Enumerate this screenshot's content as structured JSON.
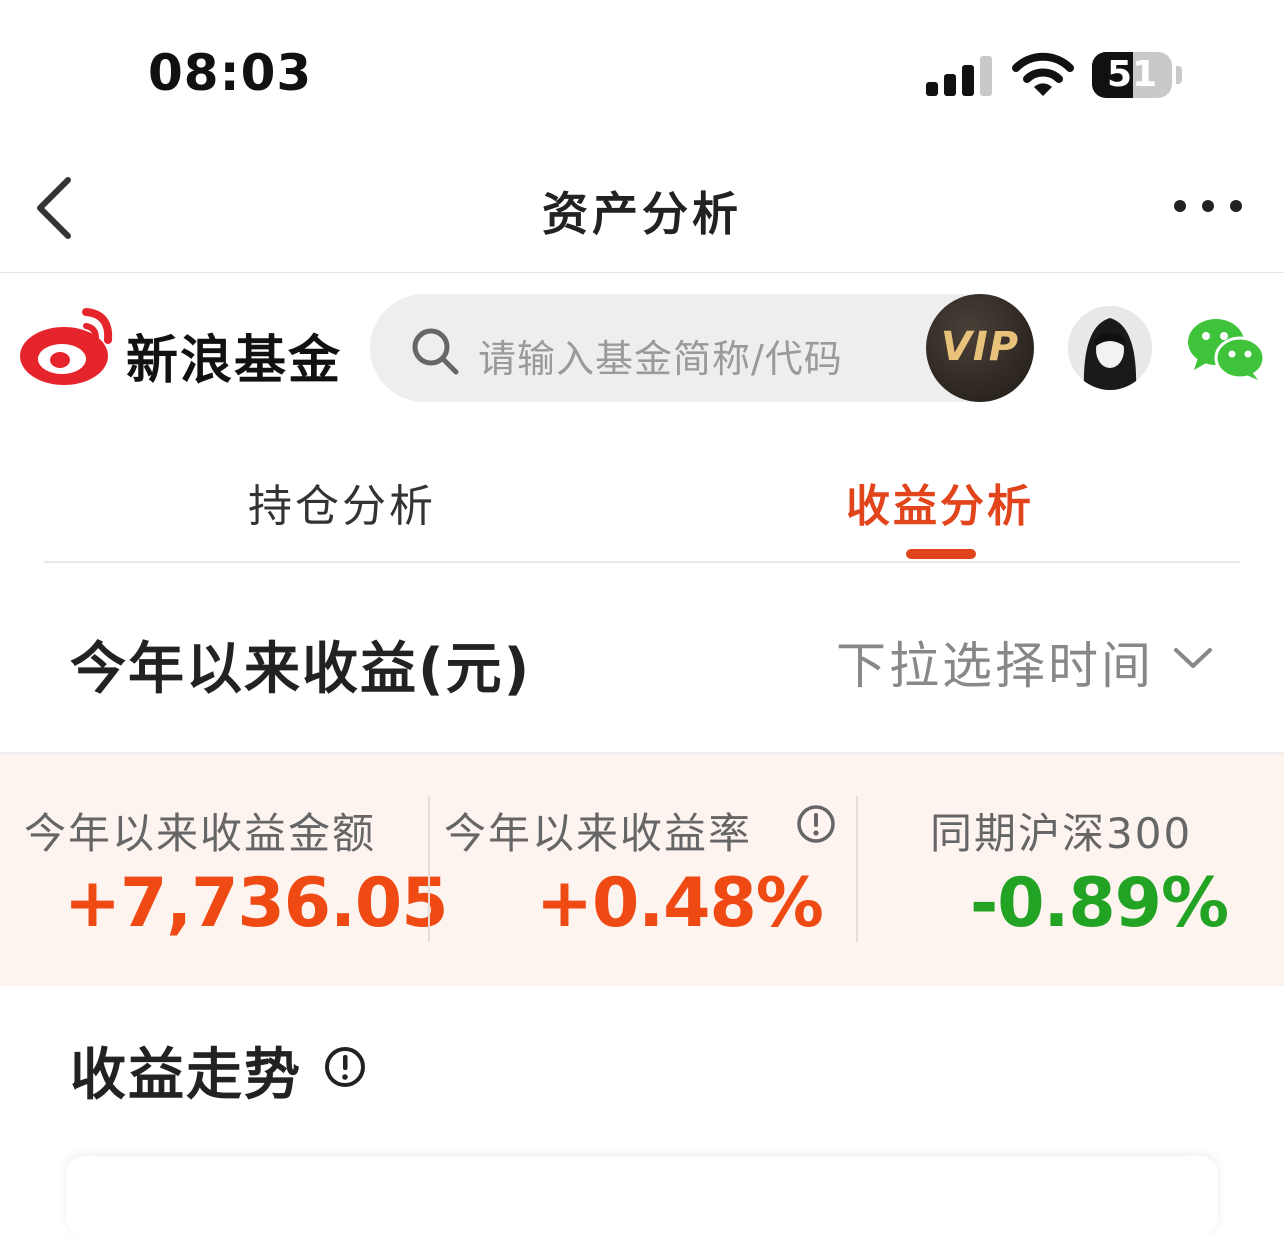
{
  "status_bar": {
    "time": "08:03",
    "battery_level": "51",
    "battery_fraction": 0.51,
    "signal_icon": "cellular-signal-icon",
    "wifi_icon": "wifi-icon"
  },
  "nav": {
    "back_icon": "chevron-left-icon",
    "title": "资产分析",
    "more_icon": "more-dots-icon"
  },
  "brand": {
    "name": "新浪基金",
    "logo_color": "#e6242b"
  },
  "search": {
    "placeholder": "请输入基金简称/代码",
    "icon": "search-icon"
  },
  "header_actions": {
    "vip_label": "VIP",
    "avatar": "user-avatar",
    "wechat_icon": "wechat-icon"
  },
  "tabs": [
    {
      "label": "持仓分析",
      "active": false
    },
    {
      "label": "收益分析",
      "active": true
    }
  ],
  "section": {
    "title": "今年以来收益(元)",
    "time_select_label": "下拉选择时间"
  },
  "stats": [
    {
      "label": "今年以来收益金额",
      "value": "+7,736.05",
      "color": "#f04a14"
    },
    {
      "label": "今年以来收益率",
      "value": "+0.48%",
      "color": "#f04a14",
      "has_info": true
    },
    {
      "label": "同期沪深300",
      "value": "-0.89%",
      "color": "#23a323"
    }
  ],
  "trend": {
    "title": "收益走势",
    "info_icon": "info-circle-icon"
  },
  "colors": {
    "accent": "#e2441c",
    "positive": "#f04a14",
    "negative": "#23a323",
    "stats_background": "#fdf4f0",
    "wechat_green": "#3ec33b"
  }
}
